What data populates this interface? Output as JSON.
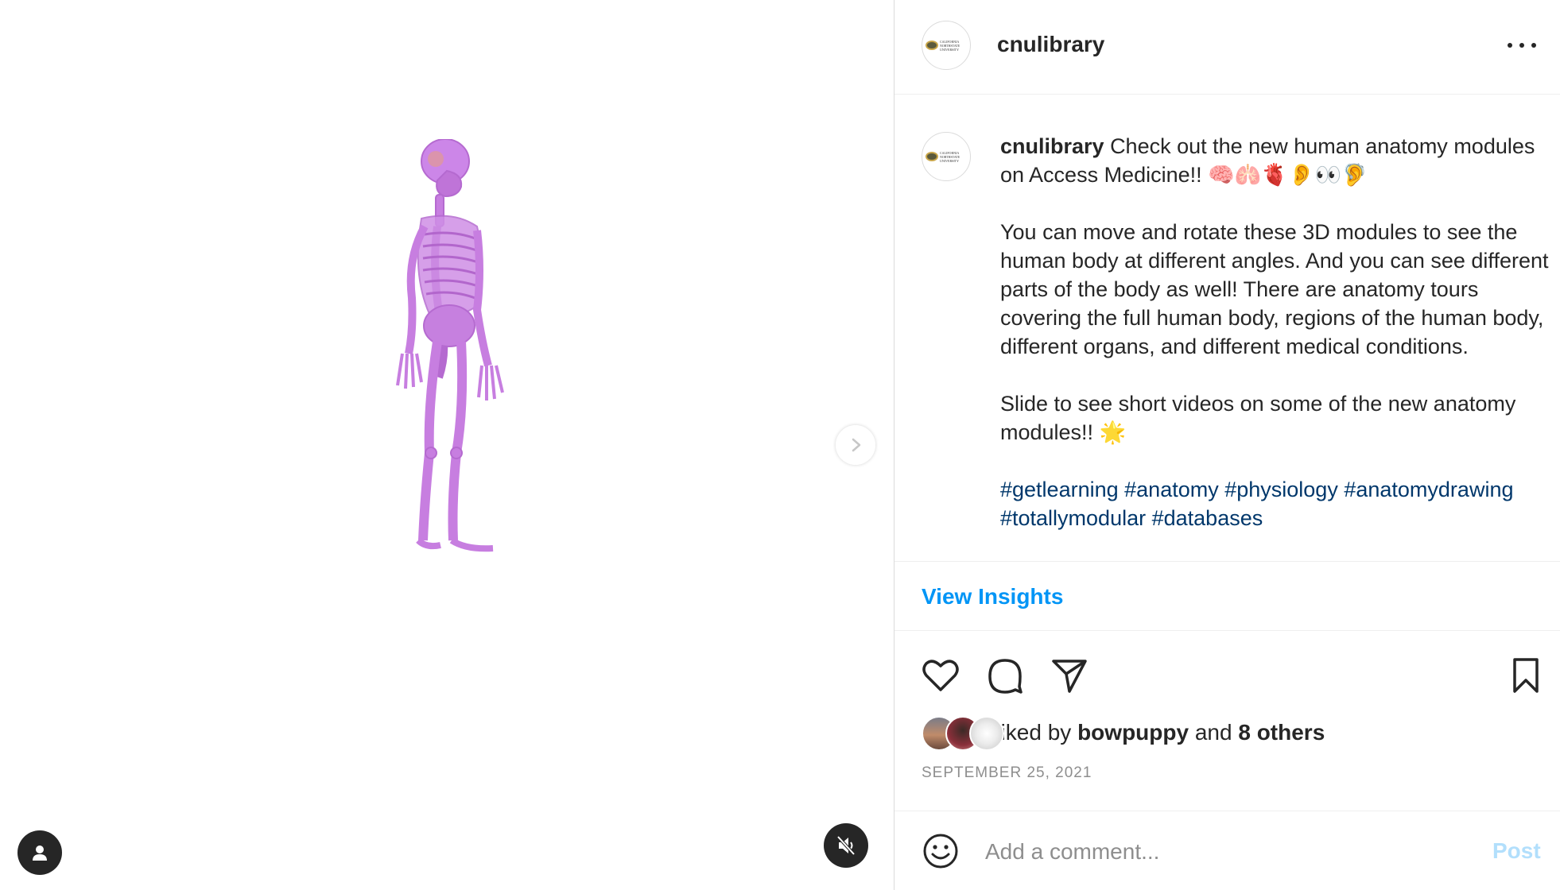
{
  "post": {
    "username": "cnulibrary",
    "avatar_alt": "California Northstate University",
    "caption": {
      "line1": "Check out the new human anatomy modules on Access Medicine!! 🧠🫁🫀👂👀🦻",
      "paragraph2": "You can move and rotate these 3D modules to see the human body at different angles. And you can see different parts of the body as well! There are anatomy tours covering the full human body, regions of the human body, different organs, and different medical conditions.",
      "paragraph3": "Slide to see short videos on some of the new anatomy modules!! 🌟",
      "hashtags": [
        "#getlearning",
        "#anatomy",
        "#physiology",
        "#anatomydrawing",
        "#totallymodular",
        "#databases"
      ]
    },
    "insights_label": "View Insights",
    "likes": {
      "prefix": "Liked by",
      "user": "bowpuppy",
      "joiner": "and",
      "others": "8 others"
    },
    "date": "SEPTEMBER 25, 2021",
    "comment": {
      "placeholder": "Add a comment...",
      "post_label": "Post"
    }
  },
  "media": {
    "subject": "3D skeleton model",
    "muted": true
  },
  "icons": {
    "more": "more-options-icon",
    "like": "heart-icon",
    "comment": "comment-icon",
    "share": "paper-plane-icon",
    "save": "bookmark-icon",
    "emoji": "smiley-icon",
    "next": "chevron-right-icon",
    "user_tag": "person-icon",
    "mute": "speaker-muted-icon"
  },
  "colors": {
    "accent": "#0095f6",
    "hashtag": "#00376b",
    "post_disabled": "#b2dffc",
    "skeleton": "#c77ee0"
  }
}
